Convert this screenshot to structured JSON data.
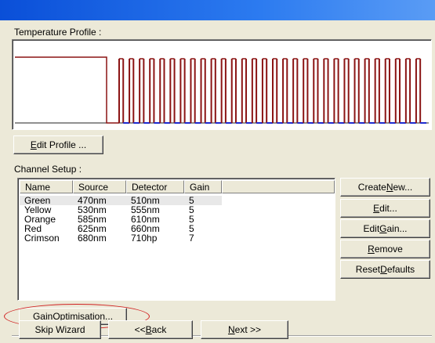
{
  "profile": {
    "label": "Temperature Profile :",
    "edit_button": {
      "mnemonic": "E",
      "rest": "dit Profile ..."
    },
    "colors": {
      "temperature_line": "#8b1414",
      "acquisition_marks": "#1e2bd0",
      "axis": "#202020"
    },
    "cycle_count": 30
  },
  "channels": {
    "label": "Channel Setup :",
    "columns": [
      "Name",
      "Source",
      "Detector",
      "Gain"
    ],
    "rows": [
      {
        "name": "Green",
        "source": "470nm",
        "detector": "510nm",
        "gain": "5"
      },
      {
        "name": "Yellow",
        "source": "530nm",
        "detector": "555nm",
        "gain": "5"
      },
      {
        "name": "Orange",
        "source": "585nm",
        "detector": "610nm",
        "gain": "5"
      },
      {
        "name": "Red",
        "source": "625nm",
        "detector": "660nm",
        "gain": "5"
      },
      {
        "name": "Crimson",
        "source": "680nm",
        "detector": "710hp",
        "gain": "7"
      }
    ],
    "selected_row": 0
  },
  "side_buttons": {
    "create_new": {
      "pre": "Create ",
      "mnemonic": "N",
      "post": "ew..."
    },
    "edit": {
      "pre": "",
      "mnemonic": "E",
      "post": "dit..."
    },
    "edit_gain": {
      "pre": "Edit ",
      "mnemonic": "G",
      "post": "ain..."
    },
    "remove": {
      "pre": "",
      "mnemonic": "R",
      "post": "emove"
    },
    "reset_defaults": {
      "pre": "Reset ",
      "mnemonic": "D",
      "post": "efaults"
    }
  },
  "gain_optimisation": {
    "pre": "Gain ",
    "mnemonic": "O",
    "post": "ptimisation...",
    "highlight_color": "#d02020"
  },
  "footer": {
    "skip": "Skip Wizard",
    "back": {
      "pre": "<< ",
      "mnemonic": "B",
      "post": "ack"
    },
    "next": {
      "pre": "",
      "mnemonic": "N",
      "post": "ext >>"
    }
  }
}
